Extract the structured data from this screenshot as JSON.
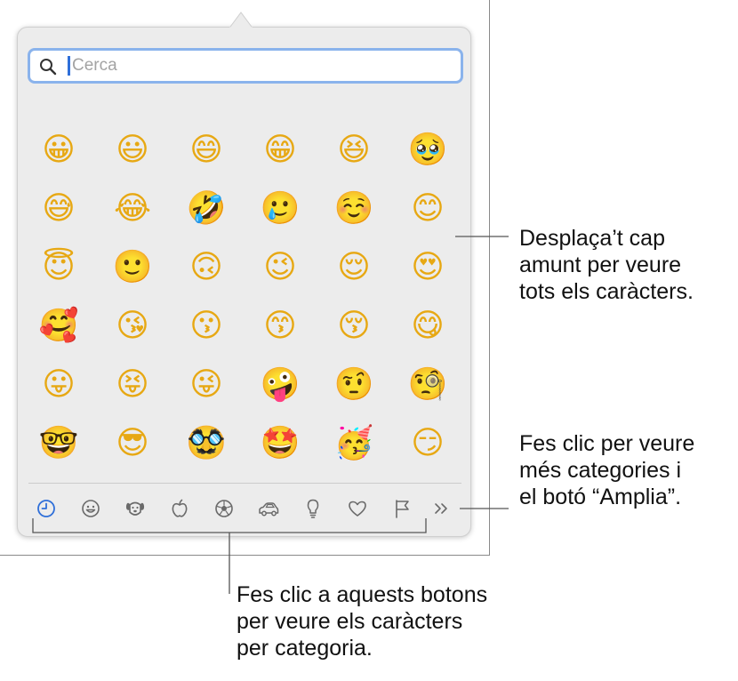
{
  "search": {
    "placeholder": "Cerca",
    "value": ""
  },
  "emoji_grid": {
    "rows": [
      [
        "😀",
        "😃",
        "😄",
        "😁",
        "😆",
        "🥹"
      ],
      [
        "😅",
        "😂",
        "🤣",
        "🥲",
        "☺️",
        "😊"
      ],
      [
        "😇",
        "🙂",
        "🙃",
        "😉",
        "😌",
        "😍"
      ],
      [
        "🥰",
        "😘",
        "😗",
        "😙",
        "😚",
        "😋"
      ],
      [
        "😛",
        "😝",
        "😜",
        "🤪",
        "🤨",
        "🧐"
      ],
      [
        "🤓",
        "😎",
        "🥸",
        "🤩",
        "🥳",
        "😏"
      ]
    ]
  },
  "categories": [
    {
      "name": "frequently-used",
      "icon": "clock-icon",
      "selected": true
    },
    {
      "name": "smileys-people",
      "icon": "smiley-icon"
    },
    {
      "name": "animals-nature",
      "icon": "dog-icon"
    },
    {
      "name": "food-drink",
      "icon": "apple-icon"
    },
    {
      "name": "activity",
      "icon": "soccer-ball-icon"
    },
    {
      "name": "travel-places",
      "icon": "car-icon"
    },
    {
      "name": "objects",
      "icon": "lightbulb-icon"
    },
    {
      "name": "symbols",
      "icon": "heart-icon"
    },
    {
      "name": "flags",
      "icon": "flag-icon"
    },
    {
      "name": "more",
      "icon": "double-chevron-right-icon"
    }
  ],
  "colors": {
    "selected_accent": "#2f6fd9",
    "icon_gray": "#6a6a6a",
    "focus_ring": "#8ab3ec",
    "popover_bg": "#ececec"
  },
  "callouts": {
    "scroll": [
      "Desplaça’t cap",
      "amunt per veure",
      "tots els caràcters."
    ],
    "more": [
      "Fes clic per veure",
      "més categories i",
      "el botó “Amplia”."
    ],
    "categories": [
      "Fes clic a aquests botons",
      "per veure els caràcters",
      "per categoria."
    ]
  }
}
